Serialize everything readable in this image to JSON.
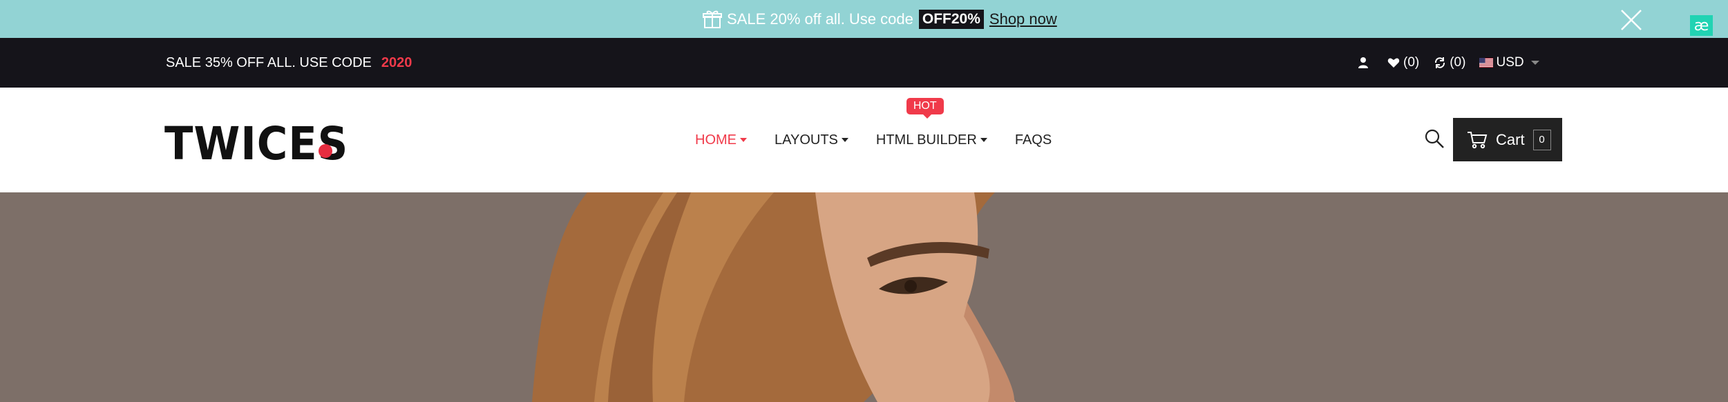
{
  "announcement": {
    "text": "SALE 20% off all. Use code",
    "code": "OFF20%",
    "link": "Shop now",
    "icons": {
      "gift": "gift-icon",
      "close": "close-icon"
    },
    "badge": "æ"
  },
  "topbar": {
    "sale_text": "SALE 35% OFF ALL. USE CODE",
    "sale_code": "2020",
    "wishlist_count": "(0)",
    "compare_count": "(0)",
    "currency": "USD"
  },
  "header": {
    "logo": "TWICES",
    "nav": [
      {
        "label": "HOME",
        "active": true
      },
      {
        "label": "LAYOUTS",
        "active": false
      },
      {
        "label": "HTML BUILDER",
        "active": false,
        "badge": "HOT"
      },
      {
        "label": "FAQS",
        "active": false
      }
    ],
    "cart_label": "Cart",
    "cart_count": "0"
  },
  "colors": {
    "announce_bg": "#92d3d4",
    "dark": "#15141a",
    "accent": "#f03a4a",
    "hero_bg": "#7d6f68"
  }
}
